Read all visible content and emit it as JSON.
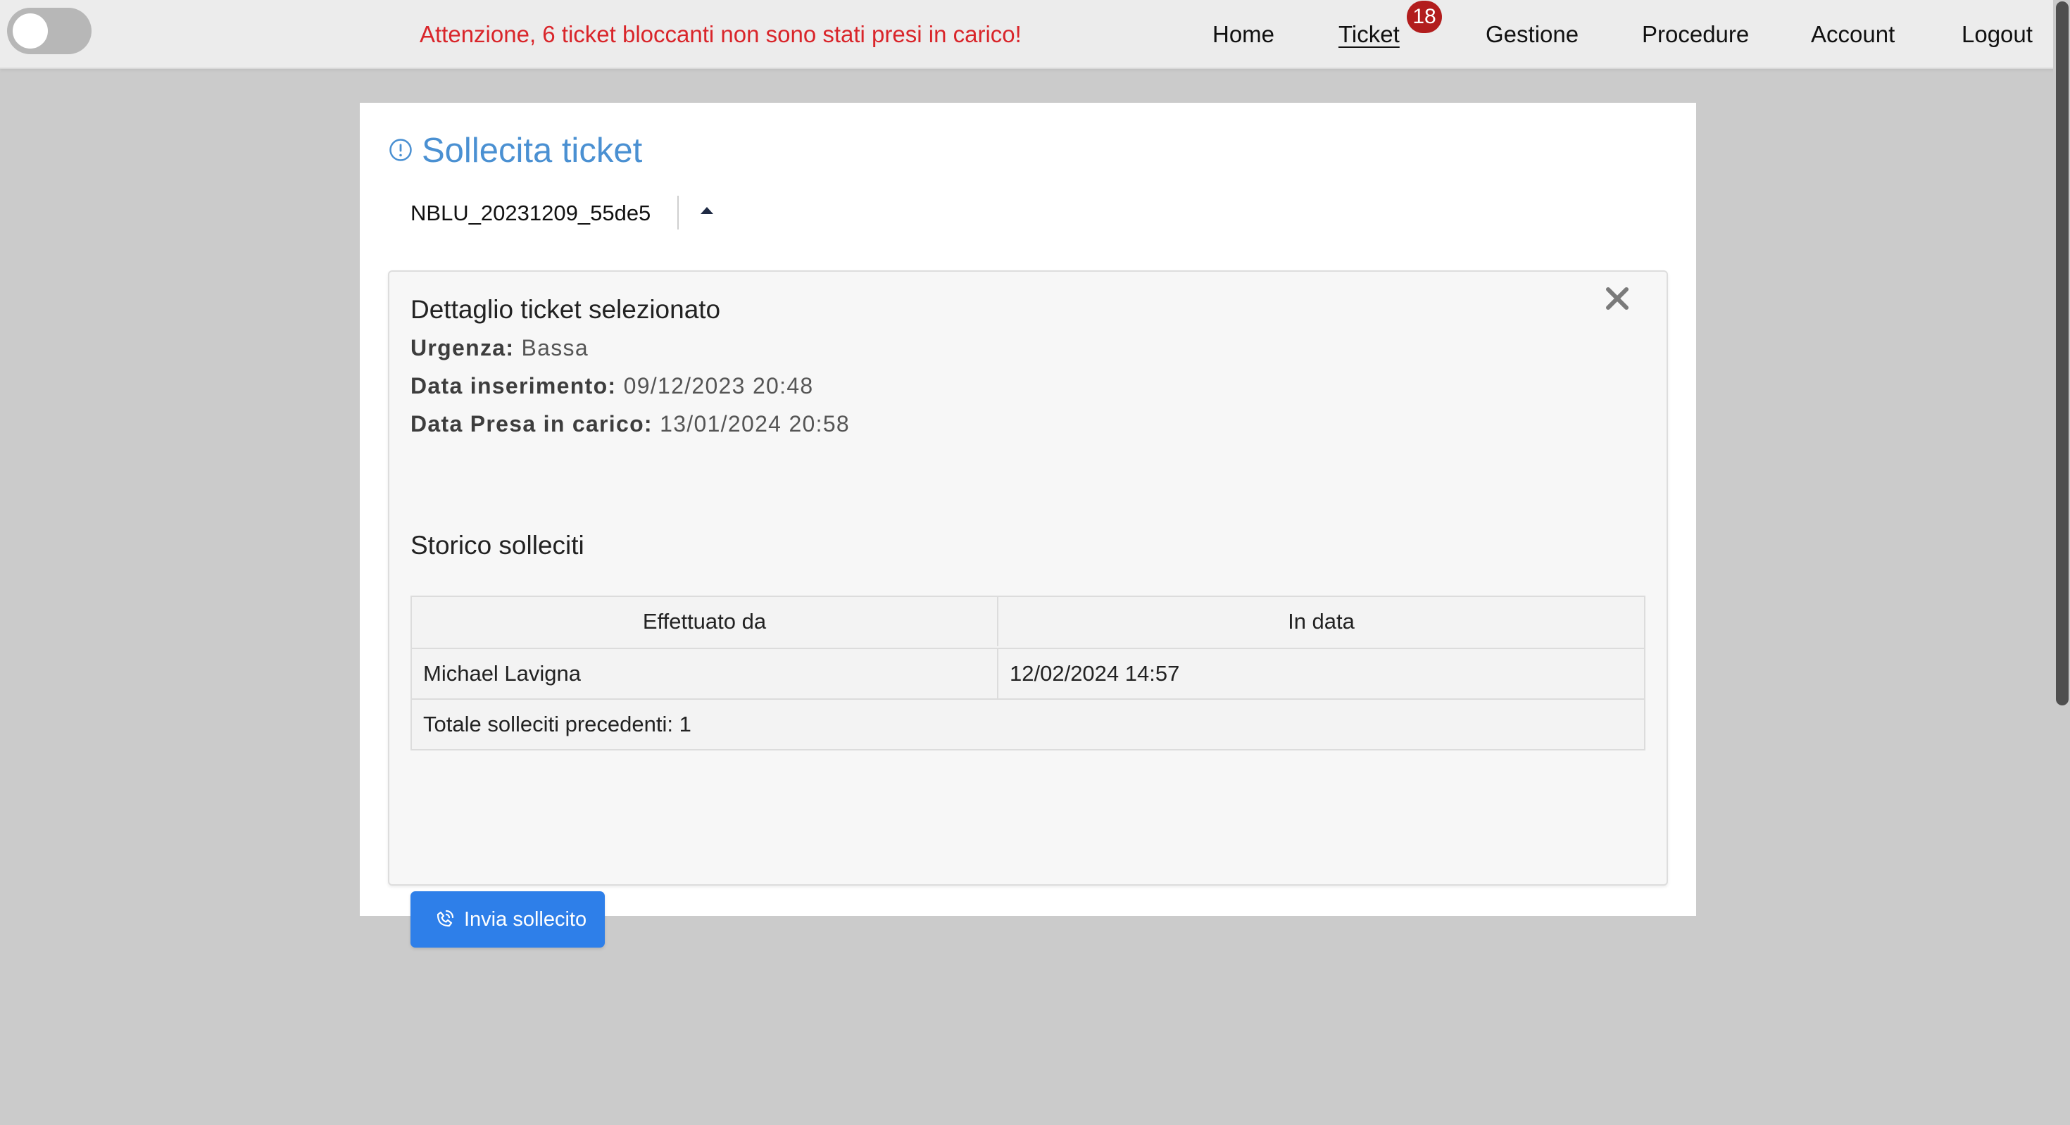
{
  "header": {
    "alert": "Attenzione, 6 ticket bloccanti non sono stati presi in carico!",
    "nav": {
      "home": "Home",
      "ticket": "Ticket",
      "ticket_badge": "18",
      "gestione": "Gestione",
      "procedure": "Procedure",
      "account": "Account",
      "logout": "Logout"
    },
    "toggle_on": false
  },
  "page": {
    "title": "Sollecita ticket",
    "title_icon": "exclamation-circle-icon",
    "selected_ticket": "NBLU_20231209_55de5",
    "select_icon": "caret-up-icon"
  },
  "detail": {
    "title": "Dettaglio ticket selezionato",
    "close_icon": "close-icon",
    "urgency_label": "Urgenza:",
    "urgency_value": "Bassa",
    "inserted_label": "Data inserimento:",
    "inserted_value": "09/12/2023 20:48",
    "taken_label": "Data Presa in carico:",
    "taken_value": "13/01/2024 20:58"
  },
  "history": {
    "title": "Storico solleciti",
    "columns": [
      "Effettuato da",
      "In data"
    ],
    "rows": [
      [
        "Michael Lavigna",
        "12/02/2024 14:57"
      ]
    ],
    "total": "Totale solleciti precedenti: 1"
  },
  "action": {
    "send_label": "Invia sollecito",
    "send_icon": "ringing-phone-icon"
  },
  "colors": {
    "alert": "#d9252a",
    "title": "#4a90d2",
    "primary_button": "#2e7fe9",
    "badge": "#b21d1d"
  }
}
